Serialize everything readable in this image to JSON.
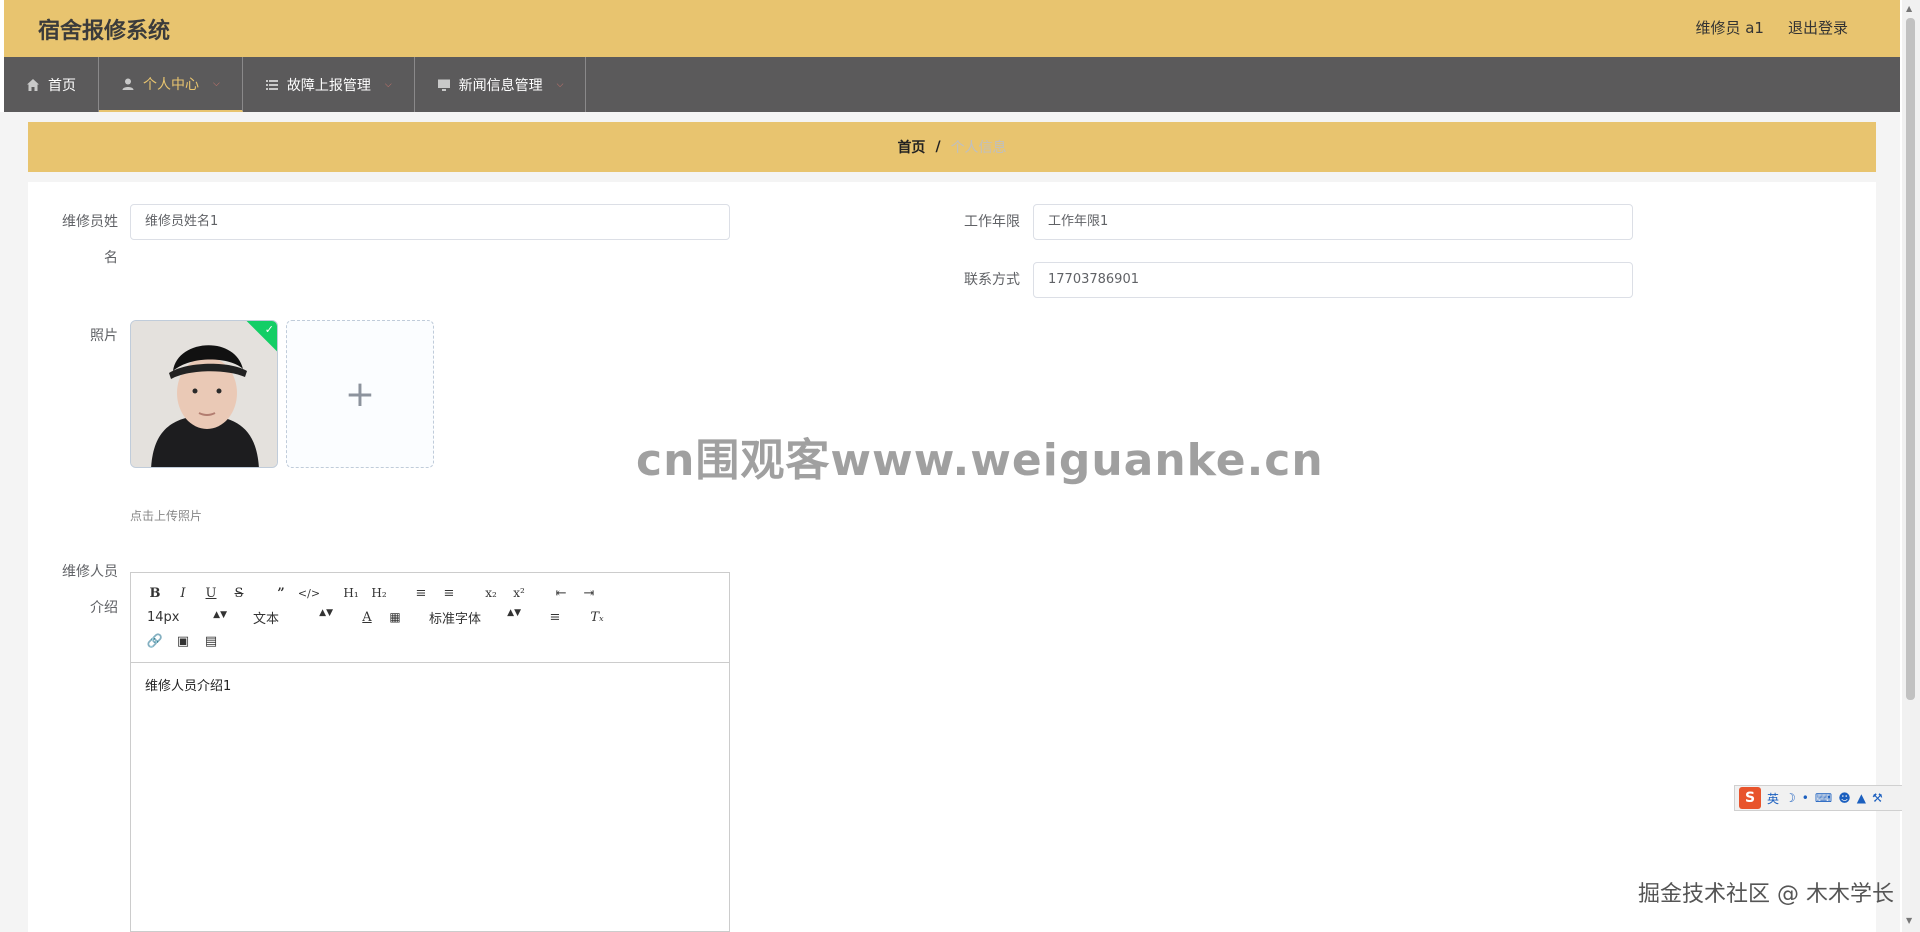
{
  "header": {
    "title": "宿舍报修系统",
    "user_label": "维修员 a1",
    "logout_label": "退出登录"
  },
  "nav": {
    "items": [
      {
        "label": "首页",
        "icon": "home-icon"
      },
      {
        "label": "个人中心",
        "icon": "user-icon"
      },
      {
        "label": "故障上报管理",
        "icon": "list-icon"
      },
      {
        "label": "新闻信息管理",
        "icon": "monitor-icon"
      }
    ],
    "active_index": 1
  },
  "breadcrumb": {
    "home": "首页",
    "separator": "/",
    "current": "个人信息"
  },
  "form": {
    "name_label_line1": "维修员姓",
    "name_label_line2": "名",
    "name_value": "维修员姓名1",
    "years_label": "工作年限",
    "years_value": "工作年限1",
    "contact_label": "联系方式",
    "contact_value": "17703786901",
    "photo_label": "照片",
    "upload_tip": "点击上传照片",
    "upload_plus": "+",
    "intro_label_line1": "维修人员",
    "intro_label_line2": "介绍"
  },
  "editor": {
    "font_size": "14px",
    "block_type": "文本",
    "font_family": "标准字体",
    "content": "维修人员介绍1"
  },
  "overlay": {
    "watermark": "cn围观客www.weiguanke.cn",
    "community": "掘金技术社区 @ 木木学长",
    "ime_s": "S",
    "ime_mode": "英"
  },
  "colors": {
    "accent": "#e8c46f",
    "nav_bg": "#5b5a5b",
    "success": "#13ce66"
  }
}
